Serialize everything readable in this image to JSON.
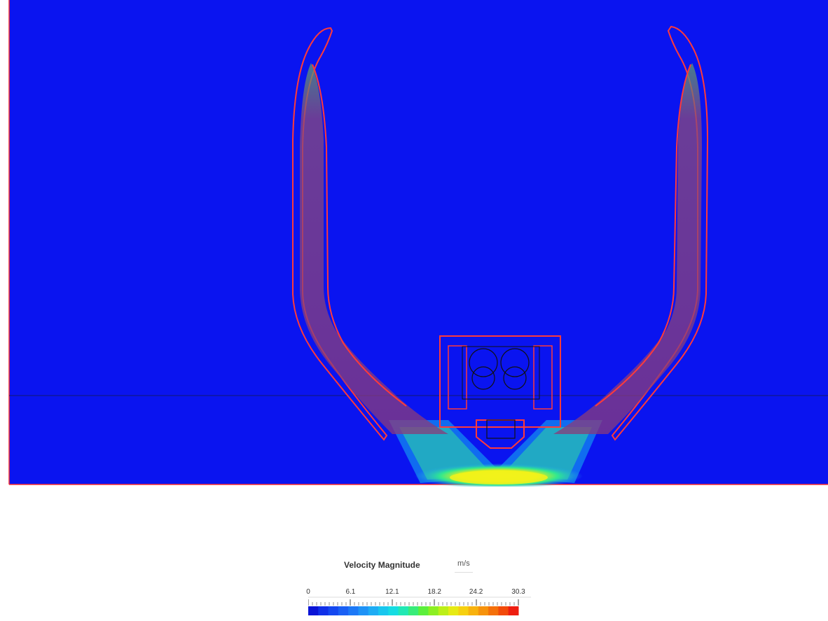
{
  "legend": {
    "title": "Velocity Magnitude",
    "unit": "m/s",
    "ticks": [
      "0",
      "6.1",
      "12.1",
      "18.2",
      "24.2",
      "30.3"
    ],
    "min": 0,
    "max": 30.3,
    "colors": [
      "#0a14d6",
      "#1030e8",
      "#1448f0",
      "#1a60f4",
      "#1c78f6",
      "#1e92f6",
      "#1eacf4",
      "#18c6ee",
      "#16dce2",
      "#22e8b4",
      "#38ec7a",
      "#5cef3c",
      "#8cef22",
      "#bcef18",
      "#e6ea14",
      "#f6d010",
      "#f8b20e",
      "#f6920c",
      "#f4700a",
      "#f24a0a",
      "#ee1e10"
    ]
  },
  "background_color": "#0a14f0",
  "outline_color": "#ff2a2a"
}
